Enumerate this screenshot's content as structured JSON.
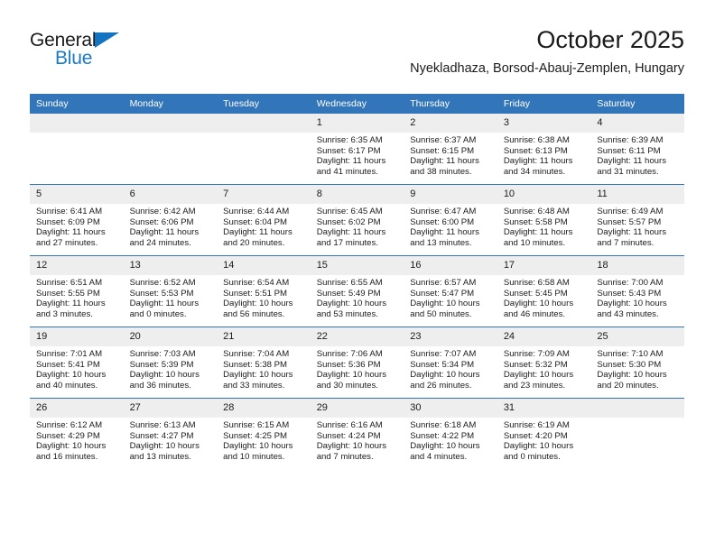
{
  "brand": {
    "name_part1": "General",
    "name_part2": "Blue",
    "triangle_icon": "triangle-icon",
    "accent_color": "#1a7bc4"
  },
  "header": {
    "title": "October 2025",
    "location": "Nyekladhaza, Borsod-Abauj-Zemplen, Hungary"
  },
  "colors": {
    "header_blue": "#3275b8",
    "daynum_gray": "#eeeeee",
    "text": "#1b1b1b"
  },
  "weekdays": [
    "Sunday",
    "Monday",
    "Tuesday",
    "Wednesday",
    "Thursday",
    "Friday",
    "Saturday"
  ],
  "weeks": [
    [
      {
        "day": "",
        "empty": true
      },
      {
        "day": "",
        "empty": true
      },
      {
        "day": "",
        "empty": true
      },
      {
        "day": "1",
        "sunrise": "Sunrise: 6:35 AM",
        "sunset": "Sunset: 6:17 PM",
        "daylight_line1": "Daylight: 11 hours",
        "daylight_line2": "and 41 minutes."
      },
      {
        "day": "2",
        "sunrise": "Sunrise: 6:37 AM",
        "sunset": "Sunset: 6:15 PM",
        "daylight_line1": "Daylight: 11 hours",
        "daylight_line2": "and 38 minutes."
      },
      {
        "day": "3",
        "sunrise": "Sunrise: 6:38 AM",
        "sunset": "Sunset: 6:13 PM",
        "daylight_line1": "Daylight: 11 hours",
        "daylight_line2": "and 34 minutes."
      },
      {
        "day": "4",
        "sunrise": "Sunrise: 6:39 AM",
        "sunset": "Sunset: 6:11 PM",
        "daylight_line1": "Daylight: 11 hours",
        "daylight_line2": "and 31 minutes."
      }
    ],
    [
      {
        "day": "5",
        "sunrise": "Sunrise: 6:41 AM",
        "sunset": "Sunset: 6:09 PM",
        "daylight_line1": "Daylight: 11 hours",
        "daylight_line2": "and 27 minutes."
      },
      {
        "day": "6",
        "sunrise": "Sunrise: 6:42 AM",
        "sunset": "Sunset: 6:06 PM",
        "daylight_line1": "Daylight: 11 hours",
        "daylight_line2": "and 24 minutes."
      },
      {
        "day": "7",
        "sunrise": "Sunrise: 6:44 AM",
        "sunset": "Sunset: 6:04 PM",
        "daylight_line1": "Daylight: 11 hours",
        "daylight_line2": "and 20 minutes."
      },
      {
        "day": "8",
        "sunrise": "Sunrise: 6:45 AM",
        "sunset": "Sunset: 6:02 PM",
        "daylight_line1": "Daylight: 11 hours",
        "daylight_line2": "and 17 minutes."
      },
      {
        "day": "9",
        "sunrise": "Sunrise: 6:47 AM",
        "sunset": "Sunset: 6:00 PM",
        "daylight_line1": "Daylight: 11 hours",
        "daylight_line2": "and 13 minutes."
      },
      {
        "day": "10",
        "sunrise": "Sunrise: 6:48 AM",
        "sunset": "Sunset: 5:58 PM",
        "daylight_line1": "Daylight: 11 hours",
        "daylight_line2": "and 10 minutes."
      },
      {
        "day": "11",
        "sunrise": "Sunrise: 6:49 AM",
        "sunset": "Sunset: 5:57 PM",
        "daylight_line1": "Daylight: 11 hours",
        "daylight_line2": "and 7 minutes."
      }
    ],
    [
      {
        "day": "12",
        "sunrise": "Sunrise: 6:51 AM",
        "sunset": "Sunset: 5:55 PM",
        "daylight_line1": "Daylight: 11 hours",
        "daylight_line2": "and 3 minutes."
      },
      {
        "day": "13",
        "sunrise": "Sunrise: 6:52 AM",
        "sunset": "Sunset: 5:53 PM",
        "daylight_line1": "Daylight: 11 hours",
        "daylight_line2": "and 0 minutes."
      },
      {
        "day": "14",
        "sunrise": "Sunrise: 6:54 AM",
        "sunset": "Sunset: 5:51 PM",
        "daylight_line1": "Daylight: 10 hours",
        "daylight_line2": "and 56 minutes."
      },
      {
        "day": "15",
        "sunrise": "Sunrise: 6:55 AM",
        "sunset": "Sunset: 5:49 PM",
        "daylight_line1": "Daylight: 10 hours",
        "daylight_line2": "and 53 minutes."
      },
      {
        "day": "16",
        "sunrise": "Sunrise: 6:57 AM",
        "sunset": "Sunset: 5:47 PM",
        "daylight_line1": "Daylight: 10 hours",
        "daylight_line2": "and 50 minutes."
      },
      {
        "day": "17",
        "sunrise": "Sunrise: 6:58 AM",
        "sunset": "Sunset: 5:45 PM",
        "daylight_line1": "Daylight: 10 hours",
        "daylight_line2": "and 46 minutes."
      },
      {
        "day": "18",
        "sunrise": "Sunrise: 7:00 AM",
        "sunset": "Sunset: 5:43 PM",
        "daylight_line1": "Daylight: 10 hours",
        "daylight_line2": "and 43 minutes."
      }
    ],
    [
      {
        "day": "19",
        "sunrise": "Sunrise: 7:01 AM",
        "sunset": "Sunset: 5:41 PM",
        "daylight_line1": "Daylight: 10 hours",
        "daylight_line2": "and 40 minutes."
      },
      {
        "day": "20",
        "sunrise": "Sunrise: 7:03 AM",
        "sunset": "Sunset: 5:39 PM",
        "daylight_line1": "Daylight: 10 hours",
        "daylight_line2": "and 36 minutes."
      },
      {
        "day": "21",
        "sunrise": "Sunrise: 7:04 AM",
        "sunset": "Sunset: 5:38 PM",
        "daylight_line1": "Daylight: 10 hours",
        "daylight_line2": "and 33 minutes."
      },
      {
        "day": "22",
        "sunrise": "Sunrise: 7:06 AM",
        "sunset": "Sunset: 5:36 PM",
        "daylight_line1": "Daylight: 10 hours",
        "daylight_line2": "and 30 minutes."
      },
      {
        "day": "23",
        "sunrise": "Sunrise: 7:07 AM",
        "sunset": "Sunset: 5:34 PM",
        "daylight_line1": "Daylight: 10 hours",
        "daylight_line2": "and 26 minutes."
      },
      {
        "day": "24",
        "sunrise": "Sunrise: 7:09 AM",
        "sunset": "Sunset: 5:32 PM",
        "daylight_line1": "Daylight: 10 hours",
        "daylight_line2": "and 23 minutes."
      },
      {
        "day": "25",
        "sunrise": "Sunrise: 7:10 AM",
        "sunset": "Sunset: 5:30 PM",
        "daylight_line1": "Daylight: 10 hours",
        "daylight_line2": "and 20 minutes."
      }
    ],
    [
      {
        "day": "26",
        "sunrise": "Sunrise: 6:12 AM",
        "sunset": "Sunset: 4:29 PM",
        "daylight_line1": "Daylight: 10 hours",
        "daylight_line2": "and 16 minutes."
      },
      {
        "day": "27",
        "sunrise": "Sunrise: 6:13 AM",
        "sunset": "Sunset: 4:27 PM",
        "daylight_line1": "Daylight: 10 hours",
        "daylight_line2": "and 13 minutes."
      },
      {
        "day": "28",
        "sunrise": "Sunrise: 6:15 AM",
        "sunset": "Sunset: 4:25 PM",
        "daylight_line1": "Daylight: 10 hours",
        "daylight_line2": "and 10 minutes."
      },
      {
        "day": "29",
        "sunrise": "Sunrise: 6:16 AM",
        "sunset": "Sunset: 4:24 PM",
        "daylight_line1": "Daylight: 10 hours",
        "daylight_line2": "and 7 minutes."
      },
      {
        "day": "30",
        "sunrise": "Sunrise: 6:18 AM",
        "sunset": "Sunset: 4:22 PM",
        "daylight_line1": "Daylight: 10 hours",
        "daylight_line2": "and 4 minutes."
      },
      {
        "day": "31",
        "sunrise": "Sunrise: 6:19 AM",
        "sunset": "Sunset: 4:20 PM",
        "daylight_line1": "Daylight: 10 hours",
        "daylight_line2": "and 0 minutes."
      },
      {
        "day": "",
        "empty": true
      }
    ]
  ]
}
